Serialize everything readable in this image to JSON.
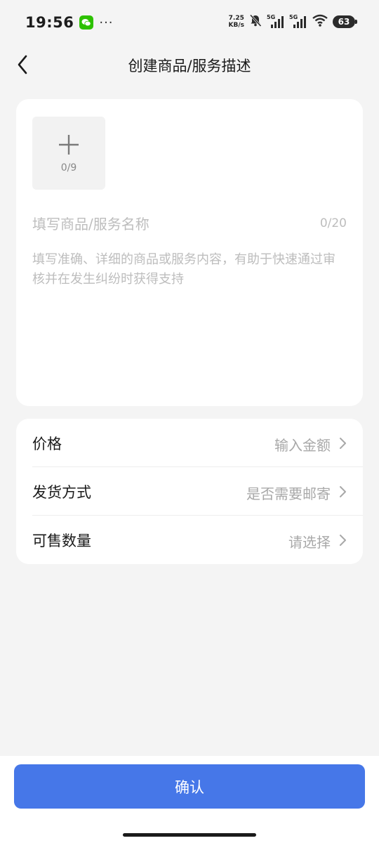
{
  "status_bar": {
    "time": "19:56",
    "more_dots": "···",
    "net_speed_value": "7.25",
    "net_speed_unit": "KB/s",
    "sim1_label": "5G",
    "sim2_label": "5G",
    "battery": "63",
    "icons": [
      "wechat-icon",
      "bell-mute-icon",
      "signal-icon",
      "signal-icon",
      "wifi-icon",
      "battery-icon"
    ]
  },
  "nav": {
    "title": "创建商品/服务描述",
    "back_icon": "chevron-left-icon"
  },
  "form": {
    "upload_count": "0/9",
    "upload_icon": "plus-icon",
    "name_placeholder": "填写商品/服务名称",
    "name_counter": "0/20",
    "desc_placeholder": "填写准确、详细的商品或服务内容，有助于快速通过审核并在发生纠纷时获得支持"
  },
  "list": [
    {
      "label": "价格",
      "value": "输入金额"
    },
    {
      "label": "发货方式",
      "value": "是否需要邮寄"
    },
    {
      "label": "可售数量",
      "value": "请选择"
    }
  ],
  "confirm_label": "确认",
  "colors": {
    "background": "#f4f4f4",
    "card": "#ffffff",
    "primary_button": "#4677e8",
    "placeholder": "#bdbdbd",
    "wechat_green": "#2dc100"
  }
}
